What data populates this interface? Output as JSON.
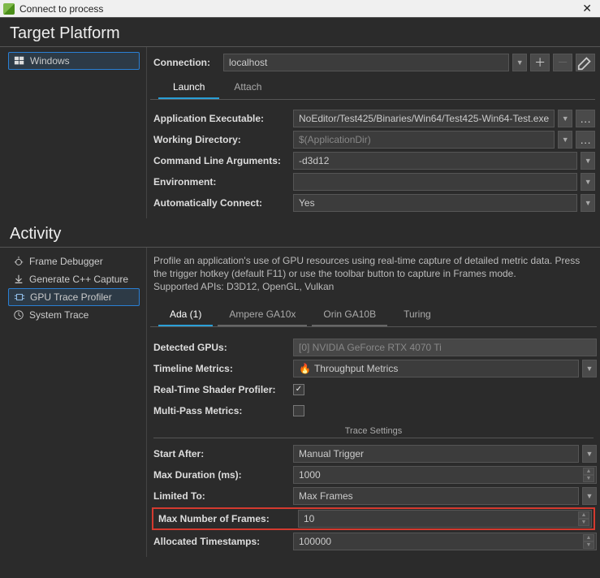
{
  "window": {
    "title": "Connect to process"
  },
  "sections": {
    "target_platform": "Target Platform",
    "activity": "Activity"
  },
  "platforms": {
    "windows": "Windows"
  },
  "connection": {
    "label": "Connection:",
    "host": "localhost"
  },
  "conn_tabs": {
    "launch": "Launch",
    "attach": "Attach"
  },
  "conn_fields": {
    "app_exe_label": "Application Executable:",
    "app_exe_value": "NoEditor/Test425/Binaries/Win64/Test425-Win64-Test.exe",
    "wd_label": "Working Directory:",
    "wd_placeholder": "$(ApplicationDir)",
    "args_label": "Command Line Arguments:",
    "args_value": "-d3d12",
    "env_label": "Environment:",
    "auto_label": "Automatically Connect:",
    "auto_value": "Yes"
  },
  "activities": {
    "frame_debugger": "Frame Debugger",
    "gen_cpp": "Generate C++ Capture",
    "gpu_trace": "GPU Trace Profiler",
    "system_trace": "System Trace"
  },
  "activity_desc": {
    "line1": "Profile an application's use of GPU resources using real-time capture of detailed metric data. Press the trigger hotkey (default F11) or use the toolbar button to capture in Frames mode.",
    "line2": "Supported APIs: D3D12, OpenGL, Vulkan"
  },
  "gpu_tabs": {
    "ada": "Ada (1)",
    "ampere": "Ampere GA10x",
    "orin": "Orin GA10B",
    "turing": "Turing"
  },
  "gpu_fields": {
    "detected_label": "Detected GPUs:",
    "detected_value": "[0] NVIDIA GeForce RTX 4070 Ti",
    "timeline_label": "Timeline Metrics:",
    "timeline_value": "Throughput Metrics",
    "rtsp_label": "Real-Time Shader Profiler:",
    "multipass_label": "Multi-Pass Metrics:"
  },
  "trace_group": "Trace Settings",
  "trace_fields": {
    "start_label": "Start After:",
    "start_value": "Manual Trigger",
    "maxdur_label": "Max Duration (ms):",
    "maxdur_value": "1000",
    "limit_label": "Limited To:",
    "limit_value": "Max Frames",
    "maxframes_label": "Max Number of Frames:",
    "maxframes_value": "10",
    "alloc_label": "Allocated Timestamps:",
    "alloc_value": "100000"
  }
}
